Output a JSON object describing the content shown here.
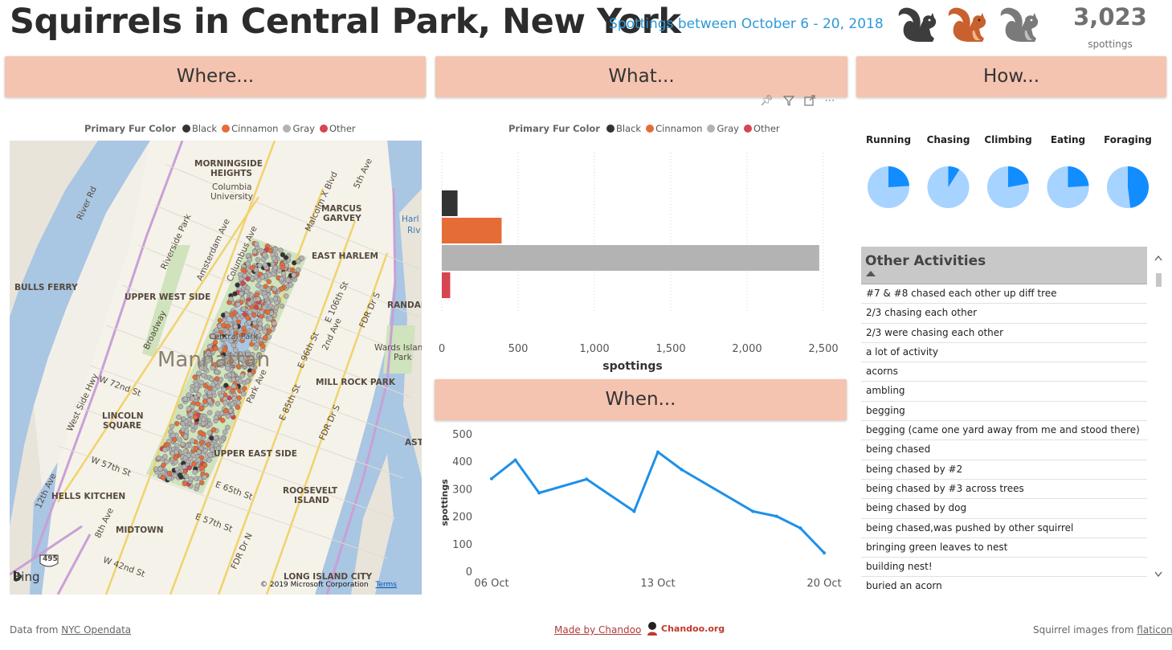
{
  "header": {
    "title": "Squirrels in Central Park, New York",
    "subtitle": "Spottings between October 6 - 20, 2018",
    "kpi_value": "3,023",
    "kpi_label": "spottings"
  },
  "sections": {
    "where": "Where...",
    "what": "What...",
    "how": "How...",
    "when": "When..."
  },
  "legend": {
    "title": "Primary Fur Color",
    "items": [
      {
        "label": "Black",
        "color": "#333333"
      },
      {
        "label": "Cinnamon",
        "color": "#e66c37"
      },
      {
        "label": "Gray",
        "color": "#b3b3b3"
      },
      {
        "label": "Other",
        "color": "#d64550"
      }
    ]
  },
  "map": {
    "labels": {
      "morningside": "MORNINGSIDE",
      "heights": "HEIGHTS",
      "columbia1": "Columbia",
      "columbia2": "University",
      "marcus1": "MARCUS",
      "marcus2": "GARVEY",
      "east_harlem": "EAST HARLEM",
      "bulls_ferry": "BULLS FERRY",
      "upper_west": "UPPER WEST SIDE",
      "randall": "RANDAL",
      "manhattan": "Manhattan",
      "wards1": "Wards Island",
      "wards2": "Park",
      "mill_rock": "MILL ROCK PARK",
      "lincoln1": "LINCOLN",
      "lincoln2": "SQUARE",
      "upper_east": "UPPER EAST SIDE",
      "roosevelt1": "ROOSEVELT",
      "roosevelt2": "ISLAND",
      "hells_kitchen": "HELLS KITCHEN",
      "midtown": "MIDTOWN",
      "lic": "LONG ISLAND CITY",
      "central_park": "Central Park",
      "harlem": "Harl",
      "riv": "Riv",
      "astoria": "ASTO",
      "river_rd": "River Rd",
      "riverside": "Riverside Park",
      "amsterdam": "Amsterdam Ave",
      "columbus": "Columbus Ave",
      "malcolm": "Malcolm X Blvd",
      "fifth_ave": "5th Ave",
      "broadway": "Broadway",
      "west_side": "West Side Hwy",
      "w72": "W 72nd St",
      "w57": "W 57th St",
      "e106": "E 106th St",
      "e96": "E 96th St",
      "e85": "E 85th St",
      "second_ave": "2nd Ave",
      "fdr1": "FDR Dr S",
      "fdr2": "FDR Dr N",
      "park_ave": "Park Ave",
      "eighth_ave": "8th Ave",
      "twelfth_ave": "12th Ave",
      "e65": "E 65th St",
      "e57": "E 57th St",
      "w42": "W 42nd St",
      "shield": "495",
      "bing": "Bing",
      "copyright": "© 2019 Microsoft Corporation",
      "terms": "Terms"
    }
  },
  "chart_data": [
    {
      "type": "bar",
      "orientation": "horizontal",
      "title": "",
      "legend_title": "Primary Fur Color",
      "categories": [
        "Black",
        "Cinnamon",
        "Gray",
        "Other"
      ],
      "values": [
        103,
        392,
        2473,
        55
      ],
      "colors": [
        "#333333",
        "#e66c37",
        "#b3b3b3",
        "#d64550"
      ],
      "xlabel": "spottings",
      "xlim": [
        0,
        2500
      ],
      "xticks": [
        "0",
        "500",
        "1,000",
        "1,500",
        "2,000",
        "2,500"
      ],
      "grid": "vertical dotted"
    },
    {
      "type": "line",
      "title": "",
      "xlabel": "",
      "ylabel": "spottings",
      "ylim": [
        0,
        500
      ],
      "yticks": [
        "0",
        "100",
        "200",
        "300",
        "400",
        "500"
      ],
      "x": [
        "2018-10-06",
        "2018-10-07",
        "2018-10-08",
        "2018-10-10",
        "2018-10-12",
        "2018-10-13",
        "2018-10-14",
        "2018-10-17",
        "2018-10-18",
        "2018-10-19",
        "2018-10-20"
      ],
      "xticks": [
        "06 Oct",
        "13 Oct",
        "20 Oct"
      ],
      "values": [
        337,
        405,
        285,
        335,
        218,
        434,
        370,
        218,
        200,
        157,
        67
      ],
      "color": "#1e90e8"
    },
    {
      "type": "pie",
      "title": "",
      "charts": [
        {
          "label": "Running",
          "fraction_true": 0.24
        },
        {
          "label": "Chasing",
          "fraction_true": 0.09
        },
        {
          "label": "Climbing",
          "fraction_true": 0.22
        },
        {
          "label": "Eating",
          "fraction_true": 0.24
        },
        {
          "label": "Foraging",
          "fraction_true": 0.48
        }
      ],
      "colors": {
        "true": "#118dff",
        "false": "#a6d3ff"
      }
    }
  ],
  "other_activities": {
    "header": "Other Activities",
    "rows": [
      "#7 & #8 chased each other up diff tree",
      "2/3 chasing each other",
      "2/3 were chasing each other",
      "a lot of activity",
      "acorns",
      "ambling",
      "begging",
      "begging (came one yard away from me and stood there)",
      "being chased",
      "being chased by #2",
      "being chased by #3 across trees",
      "being chased by dog",
      "being chased,was pushed by other squirrel",
      "bringing green leaves to nest",
      "building nest!",
      "buried an acorn"
    ]
  },
  "footer": {
    "data_prefix": "Data from ",
    "data_link": "NYC Opendata",
    "made_by": "Made by Chandoo",
    "chandoo_logo": "Chandoo.org",
    "images_prefix": "Squirrel images from ",
    "images_link": "flaticon"
  }
}
